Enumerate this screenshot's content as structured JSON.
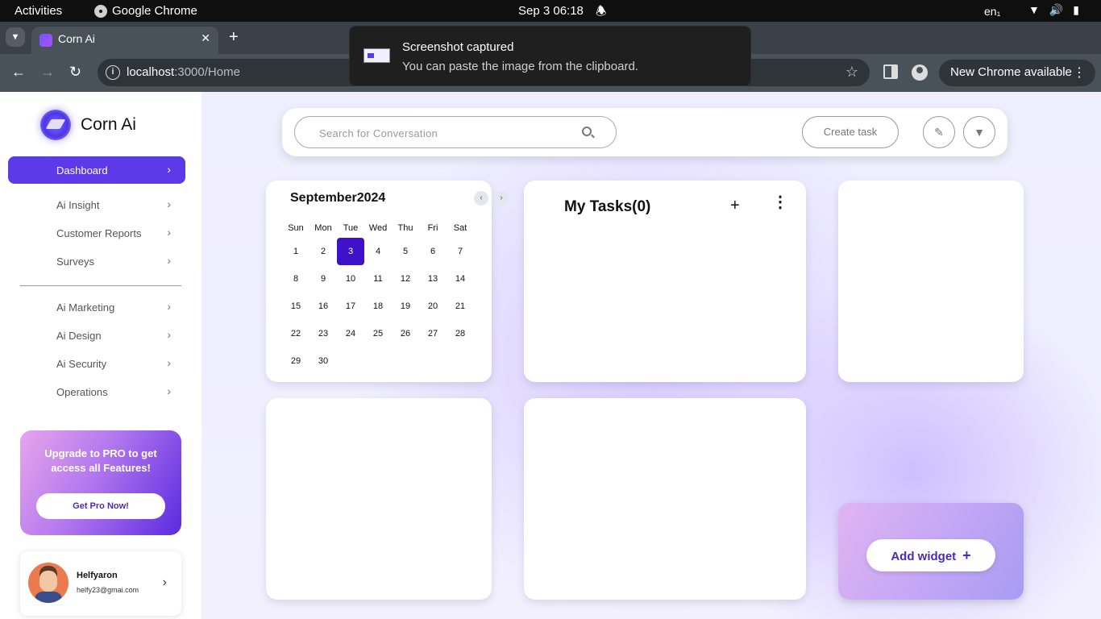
{
  "os": {
    "activities": "Activities",
    "app": "Google Chrome",
    "clock": "Sep 3  06:18",
    "lang": "en₁"
  },
  "browser": {
    "tab_title": "Corn Ai",
    "url_host": "localhost",
    "url_path": ":3000/Home",
    "update_label": "New Chrome available"
  },
  "toast": {
    "title": "Screenshot captured",
    "message": "You can paste the image from the clipboard."
  },
  "sidebar": {
    "brand": "Corn Ai",
    "items": [
      {
        "label": "Dashboard",
        "active": true
      },
      {
        "label": "Ai Insight"
      },
      {
        "label": "Customer Reports"
      },
      {
        "label": "Surveys"
      },
      {
        "label": "Ai Marketing"
      },
      {
        "label": "Ai Design"
      },
      {
        "label": "Ai Security"
      },
      {
        "label": "Operations"
      }
    ],
    "upgrade": {
      "text": "Upgrade to PRO to get access all Features!",
      "button": "Get Pro Now!"
    },
    "profile": {
      "name": "Helfyaron",
      "email": "helfy23@gmai.com"
    }
  },
  "header": {
    "search_placeholder": "Search  for  Conversation",
    "create_task": "Create task"
  },
  "calendar": {
    "title": "September2024",
    "weekdays": [
      "Sun",
      "Mon",
      "Tue",
      "Wed",
      "Thu",
      "Fri",
      "Sat"
    ],
    "first_weekday_index": 0,
    "days_in_month": 30,
    "selected_day": 3
  },
  "tasks": {
    "title": "My Tasks(0)"
  },
  "add_widget": {
    "label": "Add widget"
  },
  "colors": {
    "accent": "#5c3ae8",
    "selected_day": "#3e12c9",
    "link": "#4a2ab8"
  }
}
